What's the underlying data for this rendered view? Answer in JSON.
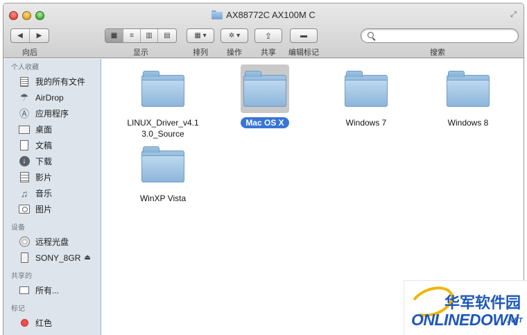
{
  "window": {
    "title": "AX88772C  AX100M C",
    "fullscreen_glyph": "⤢"
  },
  "toolbar": {
    "back_label": "向后",
    "back_glyph": "◀",
    "forward_glyph": "▶",
    "view_label": "显示",
    "view_icons": [
      "▦",
      "≡",
      "▥",
      "▤"
    ],
    "arrange_label": "排列",
    "arrange_glyph": "▦ ▾",
    "action_label": "操作",
    "action_glyph": "✲ ▾",
    "share_label": "共享",
    "share_glyph": "⇪",
    "tags_label": "编辑标记",
    "tags_glyph": "▬",
    "search_label": "搜索",
    "search_placeholder": ""
  },
  "sidebar": {
    "sections": [
      {
        "title": "个人收藏",
        "items": [
          {
            "label": "我的所有文件",
            "icon": "all-files-icon"
          },
          {
            "label": "AirDrop",
            "icon": "airdrop-icon"
          },
          {
            "label": "应用程序",
            "icon": "applications-icon"
          },
          {
            "label": "桌面",
            "icon": "desktop-icon"
          },
          {
            "label": "文稿",
            "icon": "documents-icon"
          },
          {
            "label": "下载",
            "icon": "downloads-icon"
          },
          {
            "label": "影片",
            "icon": "movies-icon"
          },
          {
            "label": "音乐",
            "icon": "music-icon"
          },
          {
            "label": "图片",
            "icon": "pictures-icon"
          }
        ]
      },
      {
        "title": "设备",
        "items": [
          {
            "label": "远程光盘",
            "icon": "remote-disc-icon"
          },
          {
            "label": "SONY_8GR",
            "icon": "usb-drive-icon",
            "eject": "⏏"
          }
        ]
      },
      {
        "title": "共享的",
        "items": [
          {
            "label": "所有...",
            "icon": "network-icon"
          }
        ]
      },
      {
        "title": "标记",
        "items": [
          {
            "label": "红色",
            "icon": "red-tag-icon",
            "color": "#f04b4b"
          }
        ]
      }
    ]
  },
  "content": {
    "folders": [
      {
        "name": "LINUX_Driver_v4.1\n3.0_Source",
        "line1": "LINUX_Driver_v4.1",
        "line2": "3.0_Source",
        "selected": false
      },
      {
        "name": "Mac OS X",
        "line1": "Mac OS X",
        "line2": "",
        "selected": true
      },
      {
        "name": "Windows 7",
        "line1": "Windows 7",
        "line2": "",
        "selected": false
      },
      {
        "name": "Windows 8",
        "line1": "Windows 8",
        "line2": "",
        "selected": false
      },
      {
        "name": "WinXP Vista",
        "line1": "WinXP Vista",
        "line2": "",
        "selected": false
      }
    ]
  },
  "watermark": {
    "cn": "华军软件园",
    "en": "ONLINEDOWN",
    "net": ".NET"
  },
  "colors": {
    "selection": "#3875d7",
    "folder": "#8db5da",
    "sidebar_bg": "#dde4ec",
    "watermark_blue": "#1d57b8",
    "watermark_gold": "#f2b400"
  }
}
